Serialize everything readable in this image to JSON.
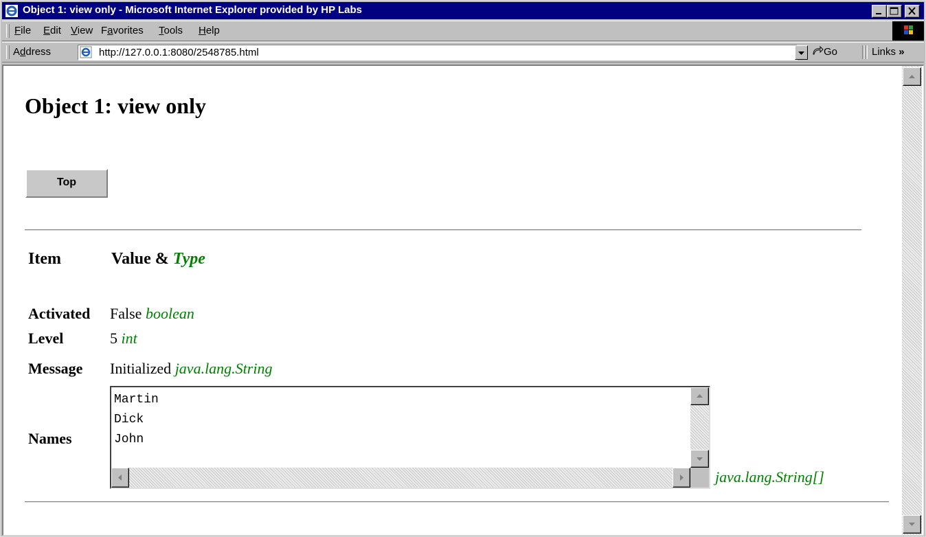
{
  "window": {
    "title": "Object 1: view only - Microsoft Internet Explorer provided by HP Labs"
  },
  "menu": {
    "items": [
      {
        "label": "File",
        "key": "F",
        "rest": "ile"
      },
      {
        "label": "Edit",
        "key": "E",
        "rest": "dit"
      },
      {
        "label": "View",
        "key": "V",
        "rest": "iew"
      },
      {
        "label": "Favorites",
        "pre": "F",
        "key": "a",
        "rest": "vorites"
      },
      {
        "label": "Tools",
        "key": "T",
        "rest": "ools"
      },
      {
        "label": "Help",
        "key": "H",
        "rest": "elp"
      }
    ]
  },
  "address": {
    "label_pre": "A",
    "label_key": "d",
    "label_rest": "dress",
    "url": "http://127.0.0.1:8080/2548785.html",
    "go_label": "Go",
    "links_label": "Links",
    "links_chevron": "»"
  },
  "page": {
    "heading": "Object 1: view only",
    "top_button": "Top",
    "col_item": "Item",
    "col_value": "Value &",
    "col_type": "Type",
    "rows": [
      {
        "item": "Activated",
        "value": "False",
        "type": "boolean"
      },
      {
        "item": "Level",
        "value": "5",
        "type": "int"
      },
      {
        "item": "Message",
        "value": "Initialized",
        "type": "java.lang.String"
      }
    ],
    "names": {
      "item": "Names",
      "lines": [
        "Martin",
        "Dick",
        "John"
      ],
      "type": "java.lang.String[]"
    }
  },
  "colors": {
    "title_bar": "#000080",
    "type_text": "#008000",
    "chrome": "#c0c0c0"
  }
}
